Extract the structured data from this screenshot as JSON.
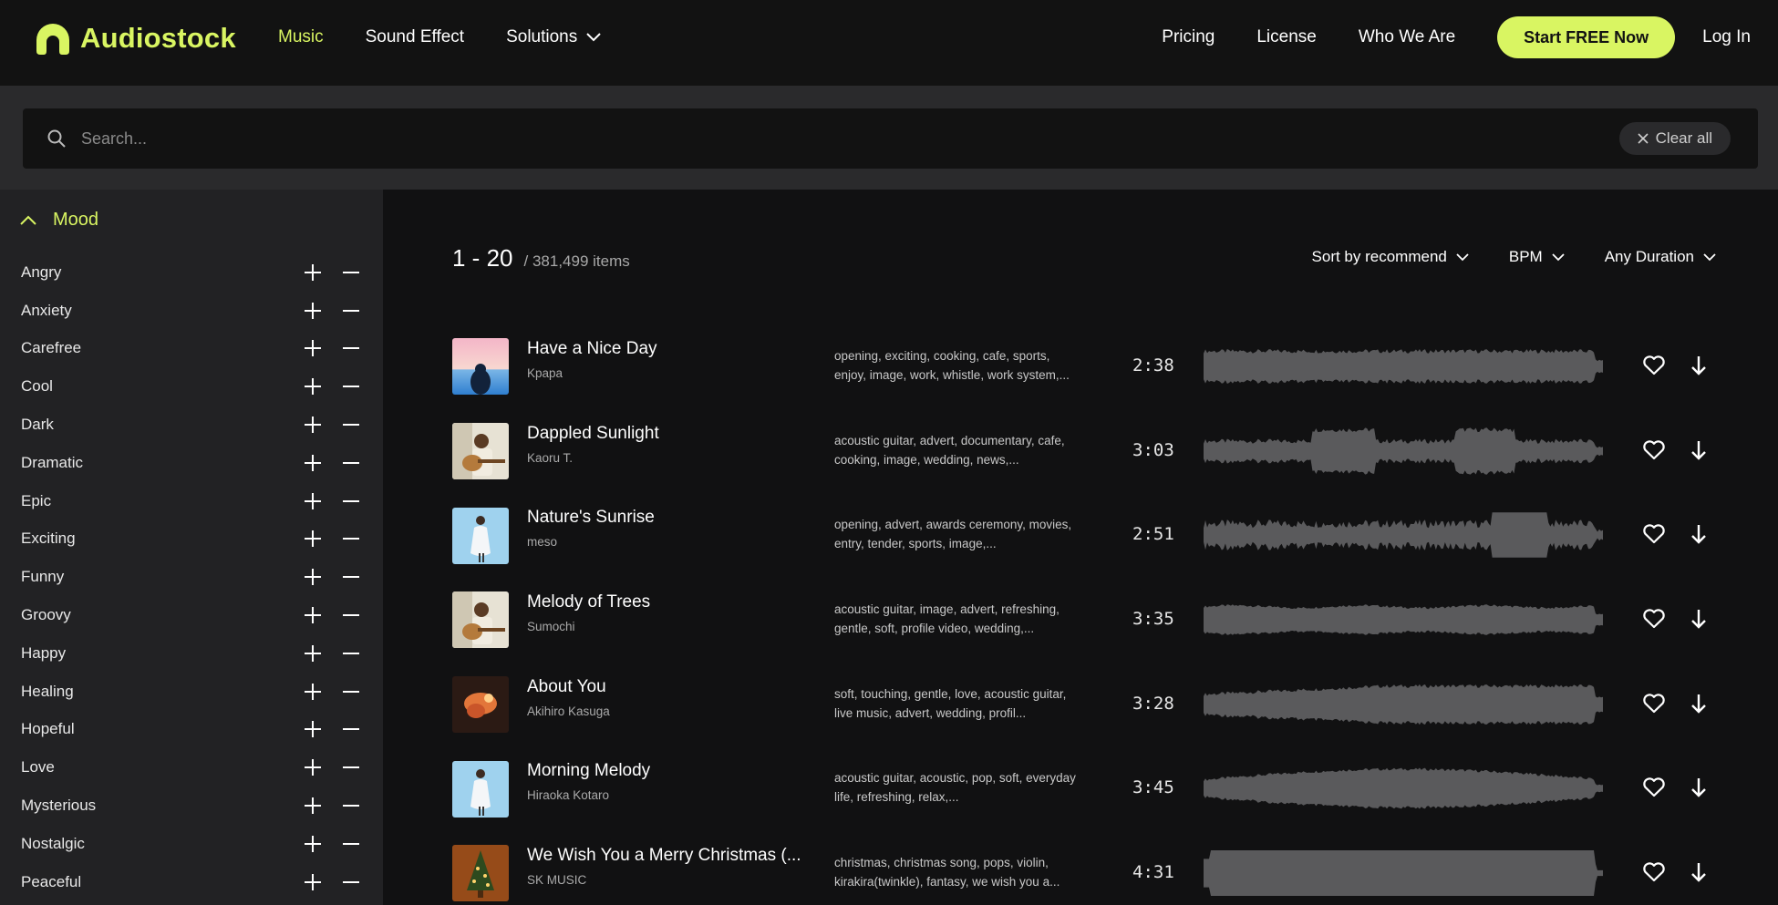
{
  "brand": {
    "name": "Audiostock",
    "accent": "#d9f562"
  },
  "nav": {
    "music": "Music",
    "sound_effect": "Sound Effect",
    "solutions": "Solutions",
    "pricing": "Pricing",
    "license": "License",
    "who_we_are": "Who We Are",
    "cta": "Start FREE Now",
    "login": "Log In"
  },
  "search": {
    "placeholder": "Search...",
    "clear_label": "Clear all"
  },
  "sidebar": {
    "section_title": "Mood",
    "moods": [
      "Angry",
      "Anxiety",
      "Carefree",
      "Cool",
      "Dark",
      "Dramatic",
      "Epic",
      "Exciting",
      "Funny",
      "Groovy",
      "Happy",
      "Healing",
      "Hopeful",
      "Love",
      "Mysterious",
      "Nostalgic",
      "Peaceful"
    ]
  },
  "results": {
    "range": "1 - 20",
    "total": "381,499 items"
  },
  "filters": {
    "sort": "Sort by recommend",
    "bpm": "BPM",
    "duration": "Any Duration"
  },
  "tracks": [
    {
      "title": "Have a Nice Day",
      "artist": "Kpapa",
      "tags": "opening, exciting, cooking, cafe, sports, enjoy, image, work, whistle, work system,...",
      "duration": "2:38",
      "thumb": "sunset",
      "wave": "dense"
    },
    {
      "title": "Dappled Sunlight",
      "artist": "Kaoru T.",
      "tags": "acoustic guitar, advert, documentary, cafe, cooking, image, wedding, news,...",
      "duration": "3:03",
      "thumb": "guitar",
      "wave": "swell"
    },
    {
      "title": "Nature's Sunrise",
      "artist": "meso",
      "tags": "opening, advert, awards ceremony, movies, entry, tender, sports, image,...",
      "duration": "2:51",
      "thumb": "figure",
      "wave": "spiky"
    },
    {
      "title": "Melody of Trees",
      "artist": "Sumochi",
      "tags": "acoustic guitar, image, advert, refreshing, gentle, soft, profile video, wedding,...",
      "duration": "3:35",
      "thumb": "guitar",
      "wave": "flat"
    },
    {
      "title": "About You",
      "artist": "Akihiro Kasuga",
      "tags": "soft, touching, gentle, love, acoustic guitar, live music, advert, wedding, profil...",
      "duration": "3:28",
      "thumb": "hands",
      "wave": "build"
    },
    {
      "title": "Morning Melody",
      "artist": "Hiraoka Kotaro",
      "tags": "acoustic guitar, acoustic, pop, soft, everyday life, refreshing, relax,...",
      "duration": "3:45",
      "thumb": "figure",
      "wave": "hump"
    },
    {
      "title": "We Wish You a Merry Christmas (...",
      "artist": "SK MUSIC",
      "tags": "christmas, christmas song, pops, violin, kirakira(twinkle), fantasy, we wish you a...",
      "duration": "4:31",
      "thumb": "tree",
      "wave": "block"
    }
  ]
}
